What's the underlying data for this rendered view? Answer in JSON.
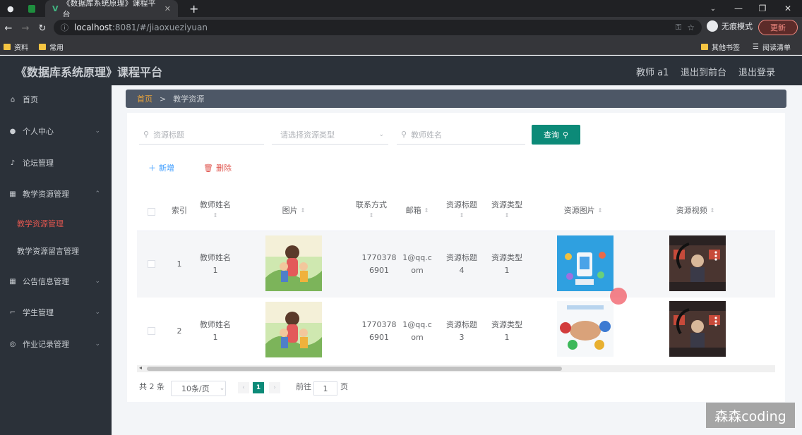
{
  "browser": {
    "tab_title": "《数据库系统原理》课程平台",
    "address_host": "localhost",
    "address_path": ":8081/#/jiaoxueziyuan",
    "incognito_label": "无痕模式",
    "update_label": "更新",
    "bookmarks": [
      "资料",
      "常用"
    ],
    "other_bookmarks": "其他书签",
    "reading_list": "阅读清单"
  },
  "header": {
    "title": "《数据库系统原理》课程平台",
    "user": "教师 a1",
    "exit_front": "退出到前台",
    "logout": "退出登录"
  },
  "sidebar": {
    "items": [
      {
        "label": "首页",
        "icon": "home-icon"
      },
      {
        "label": "个人中心",
        "icon": "user-icon"
      },
      {
        "label": "论坛管理",
        "icon": "mic-icon"
      },
      {
        "label": "教学资源管理",
        "icon": "bank-icon"
      },
      {
        "label": "公告信息管理",
        "icon": "grid-icon"
      },
      {
        "label": "学生管理",
        "icon": "crop-icon"
      },
      {
        "label": "作业记录管理",
        "icon": "compass-icon"
      }
    ],
    "sub_items": [
      "教学资源管理",
      "教学资源留言管理"
    ]
  },
  "breadcrumb": {
    "home": "首页",
    "sep": ">",
    "current": "教学资源"
  },
  "search": {
    "title_placeholder": "资源标题",
    "type_placeholder": "请选择资源类型",
    "teacher_placeholder": "教师姓名",
    "query_label": "查询"
  },
  "actions": {
    "add": "新增",
    "delete": "删除"
  },
  "table": {
    "headers": [
      "索引",
      "教师姓名",
      "图片",
      "联系方式",
      "邮箱",
      "资源标题",
      "资源类型",
      "资源图片",
      "资源视频"
    ],
    "rows": [
      {
        "index": "1",
        "teacher_a": "教师姓名",
        "teacher_b": "1",
        "phone_a": "1770378",
        "phone_b": "6901",
        "email_a": "1@qq.c",
        "email_b": "om",
        "title_a": "资源标题",
        "title_b": "4",
        "type_a": "资源类型",
        "type_b": "1"
      },
      {
        "index": "2",
        "teacher_a": "教师姓名",
        "teacher_b": "1",
        "phone_a": "1770378",
        "phone_b": "6901",
        "email_a": "1@qq.c",
        "email_b": "om",
        "title_a": "资源标题",
        "title_b": "3",
        "type_a": "资源类型",
        "type_b": "1"
      }
    ]
  },
  "pagination": {
    "total": "共 2 条",
    "page_size": "10条/页",
    "current_page": "1",
    "goto_label": "前往",
    "goto_value": "1",
    "page_unit": "页"
  },
  "watermark": "森森coding",
  "colors": {
    "primary": "#0c8a78",
    "sidebar_bg": "#2b3139",
    "active_menu": "#e0564f"
  }
}
